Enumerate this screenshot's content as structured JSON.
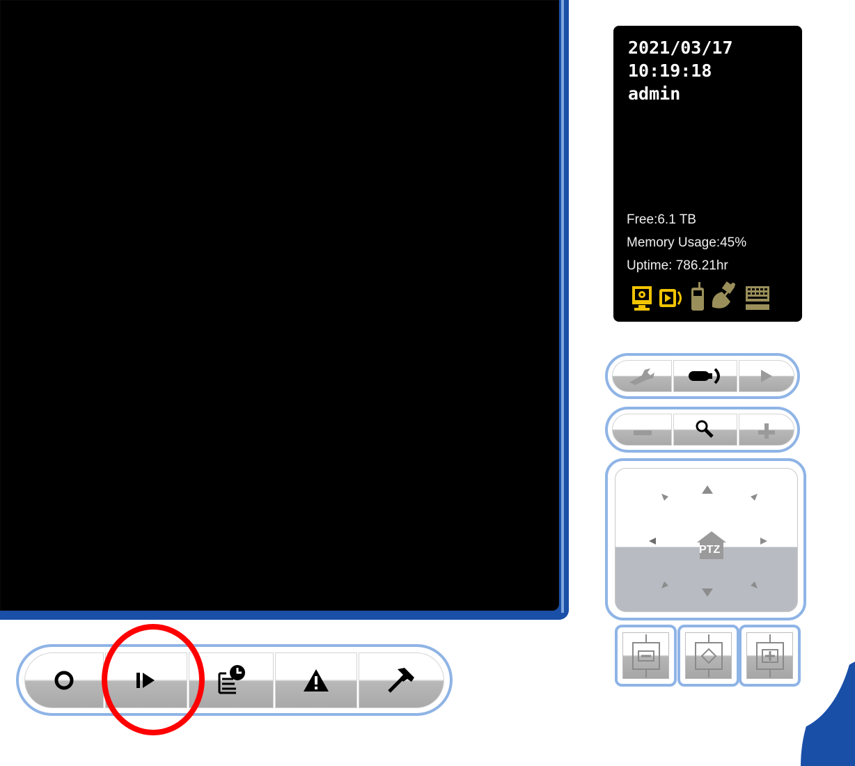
{
  "status": {
    "date": "2021/03/17",
    "time": "10:19:18",
    "user": "admin",
    "free": "Free:6.1 TB",
    "memory": "Memory Usage:45%",
    "uptime": "Uptime: 786.21hr",
    "icons": [
      "monitor-icon",
      "playback-speaker-icon",
      "mobile-phone-icon",
      "satellite-icon",
      "keyboard-icon"
    ]
  },
  "toolbar": {
    "buttons": [
      "record-icon",
      "playback-icon",
      "schedule-icon",
      "alarm-warning-icon",
      "tools-hammer-icon"
    ]
  },
  "side_controls": {
    "row1": [
      "wrench-icon",
      "camera-audio-icon",
      "play-icon"
    ],
    "row2": [
      "zoom-out-icon",
      "magnifier-icon",
      "zoom-in-icon"
    ]
  },
  "ptz": {
    "home_label": "PTZ"
  },
  "colors": {
    "frame_blue": "#1a4fa8",
    "pill_border": "#8fb4e6",
    "status_icon_yellow": "#f2c400",
    "status_icon_olive": "#9a8f5a",
    "highlight": "#ff0000"
  }
}
